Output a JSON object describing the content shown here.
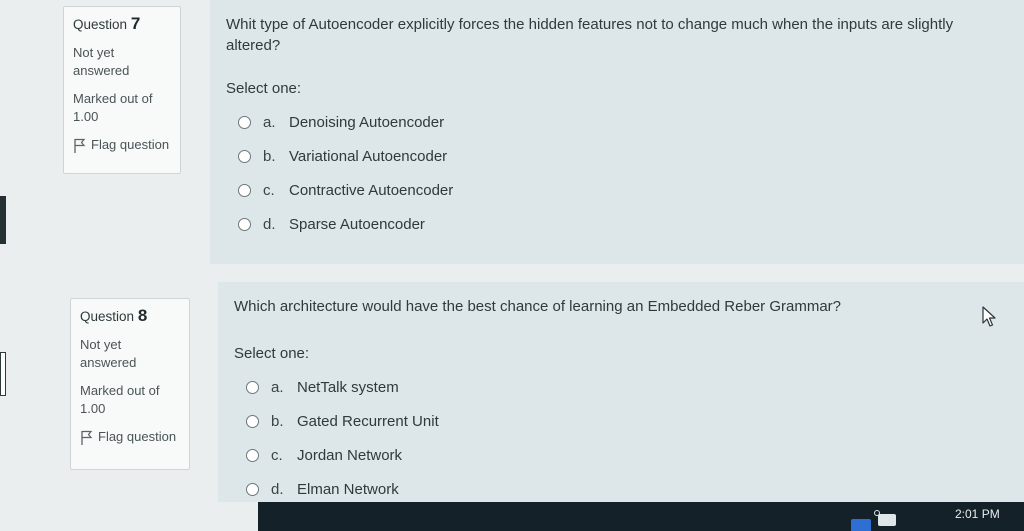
{
  "questions": [
    {
      "label": "Question",
      "number": "7",
      "status": "Not yet answered",
      "marks": "Marked out of 1.00",
      "flag": "Flag question",
      "text": "Whit type of Autoencoder explicitly forces the hidden features not to change much when the inputs are slightly altered?",
      "select_label": "Select one:",
      "options": [
        {
          "letter": "a.",
          "text": "Denoising Autoencoder"
        },
        {
          "letter": "b.",
          "text": "Variational Autoencoder"
        },
        {
          "letter": "c.",
          "text": "Contractive Autoencoder"
        },
        {
          "letter": "d.",
          "text": "Sparse Autoencoder"
        }
      ]
    },
    {
      "label": "Question",
      "number": "8",
      "status": "Not yet answered",
      "marks": "Marked out of 1.00",
      "flag": "Flag question",
      "text": "Which architecture would have the best chance of learning an Embedded Reber Grammar?",
      "select_label": "Select one:",
      "options": [
        {
          "letter": "a.",
          "text": "NetTalk system"
        },
        {
          "letter": "b.",
          "text": "Gated Recurrent Unit"
        },
        {
          "letter": "c.",
          "text": "Jordan Network"
        },
        {
          "letter": "d.",
          "text": "Elman Network"
        }
      ]
    }
  ],
  "taskbar": {
    "clock": "2:01 PM",
    "accent_color": "#2d6fd2",
    "icons": [
      "app-icon",
      "mouse-cursor-icon",
      "flag-icon"
    ]
  }
}
